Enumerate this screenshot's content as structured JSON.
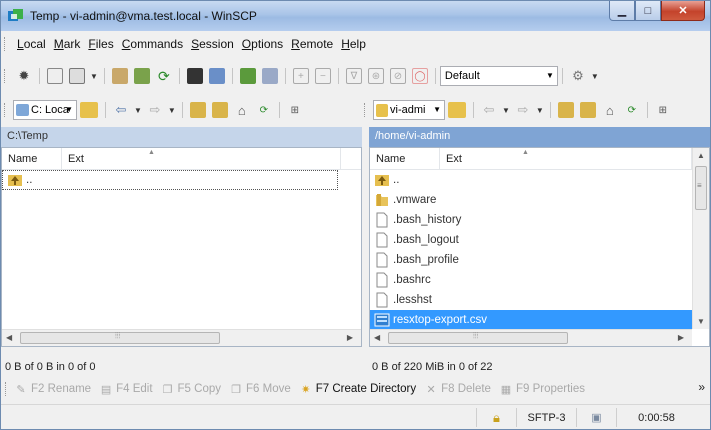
{
  "window": {
    "title": "Temp - vi-admin@vma.test.local - WinSCP"
  },
  "menu": [
    "Local",
    "Mark",
    "Files",
    "Commands",
    "Session",
    "Options",
    "Remote",
    "Help"
  ],
  "menu_underline": [
    "L",
    "M",
    "F",
    "C",
    "S",
    "O",
    "R",
    "H"
  ],
  "toolbar": {
    "transfer_preset": "Default"
  },
  "local": {
    "drive": "C: Loca",
    "path": "C:\\Temp",
    "columns": [
      "Name",
      "Ext"
    ],
    "files": [
      ".."
    ],
    "status": "0 B of 0 B in 0 of 0"
  },
  "remote": {
    "drive": "vi-admi",
    "path": "/home/vi-admin",
    "columns": [
      "Name",
      "Ext"
    ],
    "files": [
      "..",
      ".vmware",
      ".bash_history",
      ".bash_logout",
      ".bash_profile",
      ".bashrc",
      ".lesshst",
      "resxtop-export.csv"
    ],
    "selected_file": "resxtop-export.csv",
    "status": "0 B of 220 MiB in 0 of 22"
  },
  "commands": {
    "rename": "F2 Rename",
    "edit": "F4 Edit",
    "copy": "F5 Copy",
    "move": "F6 Move",
    "create_dir": "F7 Create Directory",
    "delete": "F8 Delete",
    "properties": "F9 Properties",
    "more": "»"
  },
  "statusbar": {
    "protocol": "SFTP-3",
    "elapsed": "0:00:58"
  },
  "colors": {
    "remote_path_bar": "#7fa4d4",
    "local_path_bar": "#c5d5ea",
    "selection": "#3399ff"
  }
}
